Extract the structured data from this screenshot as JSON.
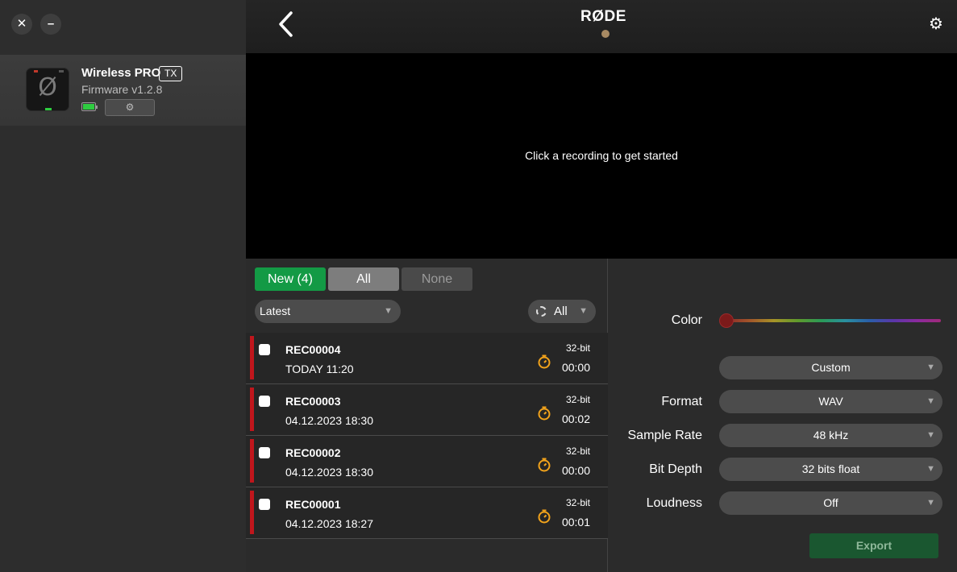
{
  "window": {
    "close_label": "✕",
    "minimize_label": "–"
  },
  "device": {
    "name": "Wireless PRO",
    "badge": "TX",
    "firmware": "Firmware v1.2.8",
    "battery_level": 1.0,
    "battery_color": "#2ecc40",
    "settings_icon": "gear-icon"
  },
  "header": {
    "brand": "RØDE",
    "back_icon": "chevron-left-icon",
    "settings_icon": "gear-icon"
  },
  "preview": {
    "message": "Click a recording to get started"
  },
  "filters": {
    "new_label": "New (4)",
    "all_label": "All",
    "none_label": "None",
    "sort_value": "Latest",
    "color_filter_value": "All"
  },
  "recordings": [
    {
      "name": "REC00004",
      "date": "TODAY 11:20",
      "bit": "32-bit",
      "duration": "00:00",
      "color": "#c0161c"
    },
    {
      "name": "REC00003",
      "date": "04.12.2023 18:30",
      "bit": "32-bit",
      "duration": "00:02",
      "color": "#c0161c"
    },
    {
      "name": "REC00002",
      "date": "04.12.2023 18:30",
      "bit": "32-bit",
      "duration": "00:00",
      "color": "#c0161c"
    },
    {
      "name": "REC00001",
      "date": "04.12.2023 18:27",
      "bit": "32-bit",
      "duration": "00:01",
      "color": "#c0161c"
    }
  ],
  "export": {
    "color_label": "Color",
    "color_value": "#7c1a1a",
    "preset_value": "Custom",
    "format_label": "Format",
    "format_value": "WAV",
    "sample_rate_label": "Sample Rate",
    "sample_rate_value": "48 kHz",
    "bit_depth_label": "Bit Depth",
    "bit_depth_value": "32 bits float",
    "loudness_label": "Loudness",
    "loudness_value": "Off",
    "export_label": "Export"
  },
  "colors": {
    "accent_green": "#139a45",
    "timer_orange": "#f2a31b",
    "background": "#2b2b2b"
  }
}
